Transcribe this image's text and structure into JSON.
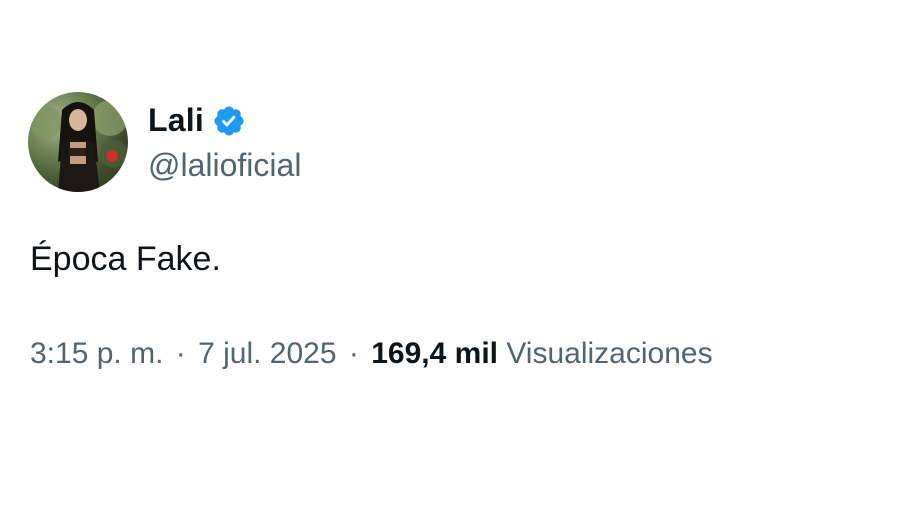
{
  "author": {
    "display_name": "Lali",
    "handle": "@lalioficial",
    "verified": true,
    "verified_color": "#1d9bf0"
  },
  "tweet": {
    "text": "Época Fake."
  },
  "meta": {
    "time": "3:15 p. m.",
    "separator": "·",
    "date": "7 jul. 2025",
    "views_count": "169,4 mil",
    "views_label": "Visualizaciones"
  },
  "icons": {
    "avatar": "profile-photo",
    "verified": "verified-badge-icon"
  }
}
